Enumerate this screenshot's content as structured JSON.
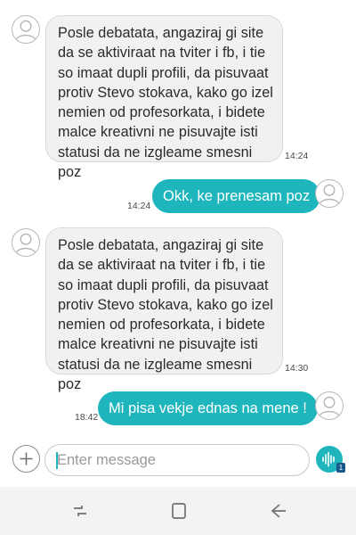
{
  "messages": [
    {
      "direction": "incoming",
      "text": "Posle debatata, angaziraj gi site\nda se aktiviraat na tviter i fb, i tie\nso imaat dupli profili, da pisuvaat\nprotiv Stevo stokava, kako go izel\nnemien od profesorkata, i bidete\nmalce kreativni ne pisuvajte isti\nstatusi da ne izgleame smesni poz",
      "time": "14:24"
    },
    {
      "direction": "outgoing",
      "text": "Okk, ke prenesam poz",
      "time": "14:24"
    },
    {
      "direction": "incoming",
      "text": "Posle debatata, angaziraj gi site\nda se aktiviraat na tviter i fb, i tie\nso imaat dupli profili, da pisuvaat\nprotiv Stevo stokava, kako go izel\nnemien od profesorkata, i bidete\nmalce kreativni ne pisuvajte isti\nstatusi da ne izgleame smesni poz",
      "time": "14:30"
    },
    {
      "direction": "outgoing",
      "text": "Mi pisa vekje ednas na mene !",
      "time": "18:42"
    }
  ],
  "composer": {
    "placeholder": "Enter message",
    "value": "",
    "add_icon": "plus-icon",
    "voice_icon": "voice-wave-icon",
    "sim_badge": "1"
  },
  "navbar": {
    "recents_icon": "recent-apps-icon",
    "home_icon": "home-icon",
    "back_icon": "back-icon"
  },
  "colors": {
    "accent": "#1fb5bd",
    "incoming_bubble": "#f1f1f1",
    "navbar_bg": "#f3f3f3",
    "sim_badge": "#155a8a"
  }
}
